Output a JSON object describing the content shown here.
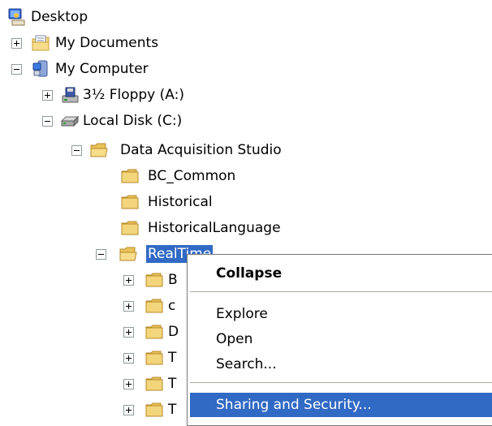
{
  "tree": {
    "desktop": {
      "label": "Desktop",
      "icon": "desktop-icon"
    },
    "my_documents": {
      "label": "My Documents",
      "icon": "my-documents-icon",
      "expander": "plus"
    },
    "my_computer": {
      "label": "My Computer",
      "icon": "my-computer-icon",
      "expander": "minus"
    },
    "floppy": {
      "label": "3½ Floppy (A:)",
      "icon": "floppy-drive-icon",
      "expander": "plus"
    },
    "local_disk": {
      "label": "Local Disk (C:)",
      "icon": "hard-disk-icon",
      "expander": "minus"
    },
    "data_acquisition_studio": {
      "label": "Data Acquisition Studio",
      "icon": "folder-open-icon",
      "expander": "minus"
    },
    "bc_common": {
      "label": "BC_Common",
      "icon": "folder-icon"
    },
    "historical": {
      "label": "Historical",
      "icon": "folder-icon"
    },
    "historical_language": {
      "label": "HistoricalLanguage",
      "icon": "folder-icon"
    },
    "realtime": {
      "label": "RealTime",
      "icon": "folder-open-icon",
      "expander": "minus",
      "selected": true
    },
    "realtime_children": [
      {
        "label": "B",
        "icon": "folder-icon",
        "expander": "plus"
      },
      {
        "label": "c",
        "icon": "folder-icon",
        "expander": "plus"
      },
      {
        "label": "D",
        "icon": "folder-icon",
        "expander": "plus"
      },
      {
        "label": "T",
        "icon": "folder-icon",
        "expander": "plus"
      },
      {
        "label": "T",
        "icon": "folder-icon",
        "expander": "plus"
      },
      {
        "label": "T",
        "icon": "folder-icon",
        "expander": "plus"
      }
    ]
  },
  "context_menu": {
    "items": [
      {
        "label": "Collapse",
        "bold": true
      },
      {
        "label": "Explore"
      },
      {
        "label": "Open"
      },
      {
        "label": "Search..."
      },
      {
        "label": "Sharing and Security...",
        "highlighted": true
      }
    ]
  },
  "colors": {
    "selection": "#316ac5",
    "folder": "#f3d57b",
    "folder_dark": "#c9a23a"
  }
}
